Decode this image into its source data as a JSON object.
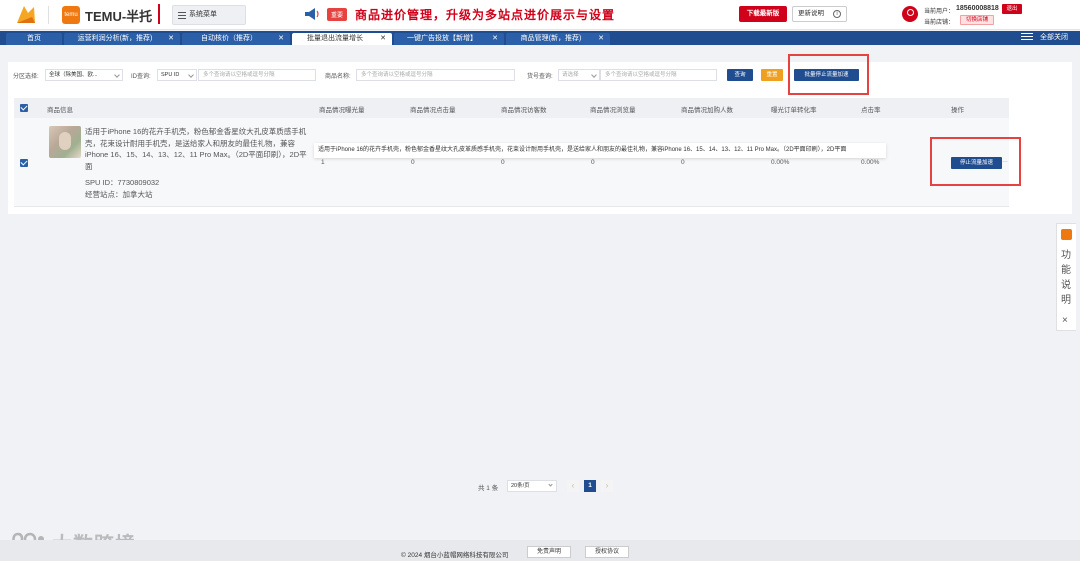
{
  "header": {
    "brand": "TEMU-半托",
    "temu_logo_text": "temu",
    "system_menu": "系统菜单",
    "notice_badge": "重要",
    "notice": "商品进价管理，升级为多站点进价展示与设置",
    "download_label": "下载最新版",
    "update_label": "更新说明",
    "current_user_label": "当前用户：",
    "current_user": "18560008818",
    "logout_label": "退出",
    "current_store_label": "当前店铺：",
    "switch_store_label": "切换店铺",
    "accent_color": "#d0021b"
  },
  "tabs": [
    {
      "label": "首页",
      "closable": false
    },
    {
      "label": "运营利润分析(新，推荐)",
      "closable": true
    },
    {
      "label": "自动核价（推荐）",
      "closable": true
    },
    {
      "label": "批量退出流量增长",
      "closable": true,
      "active": true
    },
    {
      "label": "一键广告投放【新增】",
      "closable": true
    },
    {
      "label": "商品管理(新，推荐)",
      "closable": true
    }
  ],
  "close_all_label": "全部关闭",
  "filters": {
    "region_label": "分区选择:",
    "region_value": "全球（除美国、欧...",
    "id_label": "ID查询:",
    "id_type": "SPU ID",
    "id_placeholder": "多个查询请以空格或逗号分隔",
    "name_label": "商品名称:",
    "name_placeholder": "多个查询请以空格或逗号分隔",
    "sku_label": "货号查询:",
    "sku_type": "请选择",
    "sku_placeholder": "多个查询请以空格或逗号分隔",
    "query_label": "查询",
    "reset_label": "重置",
    "batch_stop_label": "批量停止流量加速"
  },
  "table": {
    "headers": [
      "商品信息",
      "商品情况曝光量",
      "商品情况点击量",
      "商品情况访客数",
      "商品情况浏览量",
      "商品情况加购人数",
      "曝光订单转化率",
      "点击率",
      "操作"
    ],
    "rows": [
      {
        "title": "适用于iPhone 16的花卉手机壳，粉色郁金香星纹大孔皮革质感手机壳，花束设计耐用手机壳，是送给家人和朋友的最佳礼物，兼容iPhone 16、15、14、13、12、11 Pro Max。（2D平面印刷），2D平面",
        "spu_id": "SPU ID：7730809032",
        "site": "经营站点：加拿大站",
        "tooltip": "适用于iPhone 16的花卉手机壳，粉色郁金香星纹大孔皮革质感手机壳，花束设计耐用手机壳，是送给家人和朋友的最佳礼物，兼容iPhone 16、15、14、13、12、11 Pro Max。（2D平面印刷），2D平面",
        "exposure": "1",
        "clicks": "0",
        "visitors": "0",
        "views": "0",
        "cart_adds": "0",
        "conversion": "0.00%",
        "ctr": "0.00%",
        "action_label": "停止流量加速"
      }
    ]
  },
  "pagination": {
    "total": "共 1 条",
    "page_size": "20条/页",
    "prev": "‹",
    "current": "1",
    "next": "›"
  },
  "side_widget": {
    "text": "功能说明",
    "close": "×"
  },
  "watermark": "大数跨境",
  "footer": {
    "copyright": "© 2024 烟台小蓝帽网络科技有限公司",
    "disclaimer": "免责声明",
    "license": "授权协议"
  }
}
